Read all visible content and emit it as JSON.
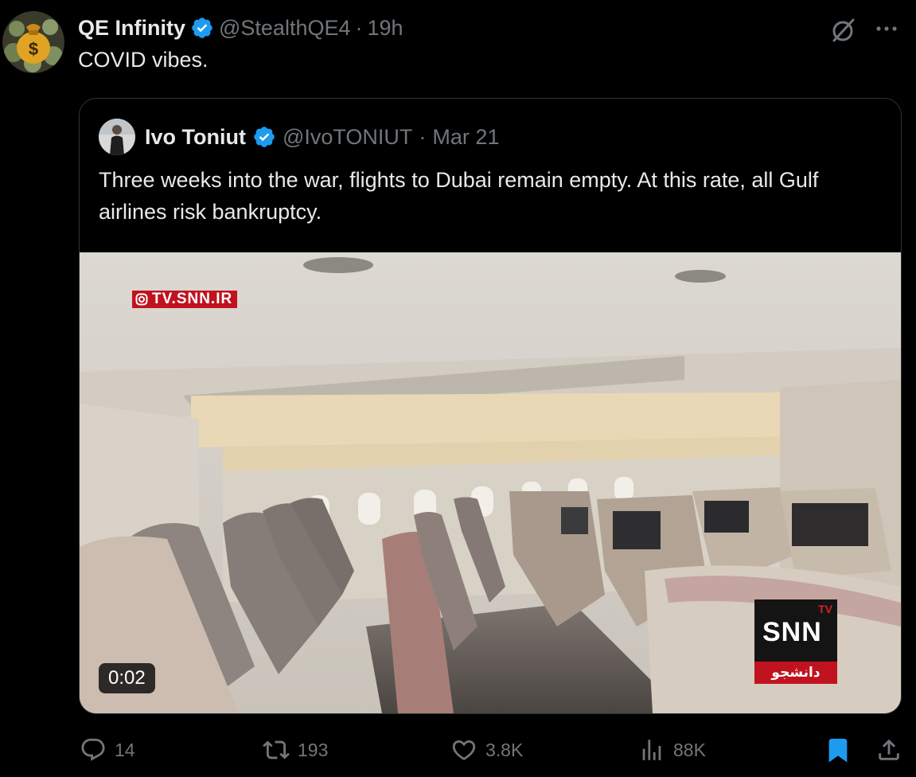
{
  "tweet": {
    "author_name": "QE Infinity",
    "author_handle": "@StealthQE4",
    "time": "19h",
    "separator": "·",
    "text": "COVID vibes."
  },
  "quoted_tweet": {
    "author_name": "Ivo Toniut",
    "author_handle": "@IvoTONIUT",
    "time": "Mar 21",
    "separator": "·",
    "text": "Three weeks into the war, flights to Dubai remain empty. At this rate, all Gulf airlines risk bankruptcy.",
    "media": {
      "watermark": "TV.SNN.IR",
      "logo_tv": "TV",
      "logo_text": "SNN",
      "logo_subtext": "دانشجو",
      "duration": "0:02"
    }
  },
  "actions": {
    "replies": "14",
    "reposts": "193",
    "likes": "3.8K",
    "views": "88K"
  },
  "colors": {
    "background": "#000000",
    "text": "#e7e9ea",
    "muted": "#71767b",
    "verified": "#1d9bf0",
    "bookmark_active": "#1d9bf0",
    "border": "#2f3336"
  },
  "icons": [
    "money-bag-icon",
    "verified-badge-icon",
    "grok-icon",
    "more-icon",
    "reply-icon",
    "repost-icon",
    "like-icon",
    "views-icon",
    "bookmark-icon",
    "share-icon",
    "instagram-icon"
  ]
}
